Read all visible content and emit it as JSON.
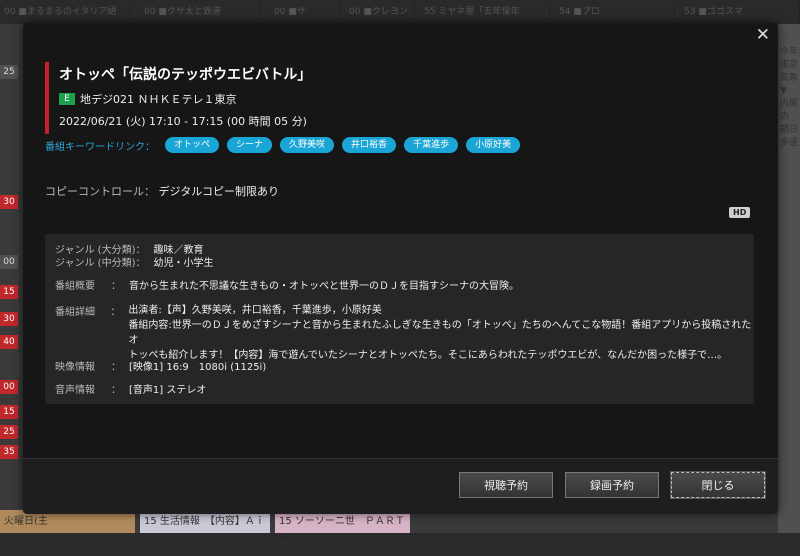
{
  "modal": {
    "close_symbol": "✕",
    "program": {
      "title": "オトッペ「伝説のテッポウエビバトル」",
      "channel_badge": "E",
      "channel": "地デジ021 ＮＨＫＥテレ１東京",
      "time": "2022/06/21 (火)  17:10 - 17:15  (00 時間 05 分)"
    },
    "keywords": {
      "label": "番組キーワードリンク：",
      "tags": [
        "オトッペ",
        "シーナ",
        "久野美咲",
        "井口裕香",
        "千葉進歩",
        "小原好美"
      ]
    },
    "copy_control": {
      "label": "コピーコントロール：",
      "value": "デジタルコピー制限あり"
    },
    "hd_badge": "HD",
    "info": {
      "genre_major_label": "ジャンル (大分類)",
      "genre_major": "趣味／教育",
      "genre_minor_label": "ジャンル (中分類)",
      "genre_minor": "幼児・小学生",
      "summary_label": "番組概要",
      "summary": "音から生まれた不思議な生きもの・オトッペと世界一のＤＪを目指すシーナの大冒険。",
      "detail_label": "番組詳細",
      "detail_lines": [
        "出演者:【声】久野美咲，井口裕香，千葉進歩，小原好美",
        "番組内容:世界一のＤＪをめざすシーナと音から生まれたふしぎな生きもの「オトッペ」たちのへんてこな物語！番組アプリから投稿されたオ",
        "トッペも紹介します！【内容】海で遊んでいたシーナとオトッペたち。そこにあらわれたテッポウエビが、なんだか困った様子で…。"
      ],
      "video_label": "映像情報",
      "video": "[映像1] 16:9　1080i (1125i)",
      "audio_label": "音声情報",
      "audio": "[音声1] ステレオ"
    },
    "buttons": {
      "watch_reserve": "視聴予約",
      "record_reserve": "録画予約",
      "close": "閉じる"
    }
  },
  "background": {
    "top_cells": [
      "00 ■まるまるのイタリア語",
      "00 ■クサ太と鉄道",
      "00 ■サ",
      "00 ■クレヨン",
      "55 ミヤネ屋「五年保年",
      "54 ■ブロ",
      "53 ■ゴゴスマ"
    ],
    "left_minutes": [
      "25",
      "30",
      "00",
      "15",
      "30",
      "40",
      "00",
      "15",
      "25",
      "35"
    ],
    "right_texts": [
      "今年",
      "東京",
      "気象▼",
      "内閣",
      "の",
      "朝日",
      "多送"
    ],
    "bottom_left": "火曜日(主",
    "bottom_mid": "15 生活情報　【内容】Ａｉ",
    "bottom_right": "15 ソーソーニ世　ＰＡＲＴ６"
  }
}
